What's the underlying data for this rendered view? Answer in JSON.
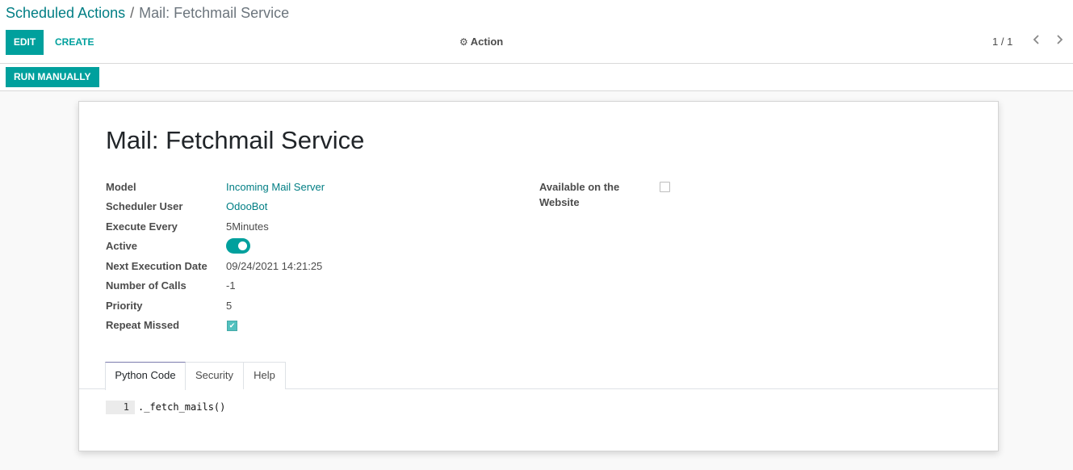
{
  "breadcrumb": {
    "parent": "Scheduled Actions",
    "separator": "/",
    "current": "Mail: Fetchmail Service"
  },
  "toolbar": {
    "edit_label": "EDIT",
    "create_label": "CREATE",
    "action_label": "Action",
    "action_icon": "gear-icon"
  },
  "pager": {
    "value": "1 / 1",
    "prev_icon": "chevron-left-icon",
    "next_icon": "chevron-right-icon"
  },
  "statusbar": {
    "run_label": "RUN MANUALLY"
  },
  "record": {
    "title": "Mail: Fetchmail Service",
    "fields": [
      {
        "label": "Model",
        "value": "Incoming Mail Server"
      },
      {
        "label": "Scheduler User",
        "value": "OdooBot"
      },
      {
        "label": "Execute Every",
        "value": "5Minutes"
      },
      {
        "label": "Active",
        "value": true
      },
      {
        "label": "Next Execution Date",
        "value": "09/24/2021 14:21:25"
      },
      {
        "label": "Number of Calls",
        "value": "-1"
      },
      {
        "label": "Priority",
        "value": "5"
      },
      {
        "label": "Repeat Missed",
        "value": true
      }
    ],
    "website": {
      "label": "Available on the Website",
      "checked": false
    }
  },
  "tabs": [
    {
      "label": "Python Code",
      "active": true
    },
    {
      "label": "Security",
      "active": false
    },
    {
      "label": "Help",
      "active": false
    }
  ],
  "code": {
    "line_number": "1",
    "line": "._fetch_mails()"
  },
  "colors": {
    "primary": "#00a09d",
    "link": "#017e84",
    "tab_active_top": "#7c7bad"
  }
}
